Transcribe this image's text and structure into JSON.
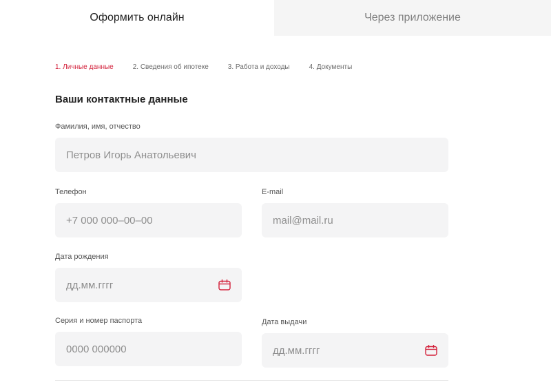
{
  "tabs": [
    {
      "label": "Оформить онлайн",
      "active": true
    },
    {
      "label": "Через приложение",
      "active": false
    }
  ],
  "steps": [
    {
      "label": "1. Личные данные",
      "active": true
    },
    {
      "label": "2. Сведения об ипотеке",
      "active": false
    },
    {
      "label": "3. Работа и доходы",
      "active": false
    },
    {
      "label": "4. Документы",
      "active": false
    }
  ],
  "section_title": "Ваши контактные данные",
  "form": {
    "full_name": {
      "label": "Фамилия, имя, отчество",
      "placeholder": "Петров Игорь Анатольевич"
    },
    "phone": {
      "label": "Телефон",
      "placeholder": "+7 000 000–00–00"
    },
    "email": {
      "label": "E-mail",
      "placeholder": "mail@mail.ru"
    },
    "birth_date": {
      "label": "Дата рождения",
      "placeholder": "дд.мм.гггг",
      "icon": "calendar-icon"
    },
    "passport": {
      "label": "Серия и номер паспорта",
      "placeholder": "0000 000000"
    },
    "issue_date": {
      "label": "Дата выдачи",
      "placeholder": "дд.мм.гггг",
      "icon": "calendar-icon"
    }
  },
  "colors": {
    "accent": "#d3213b",
    "field_bg": "#f4f4f5",
    "inactive_tab_bg": "#f5f5f5"
  }
}
